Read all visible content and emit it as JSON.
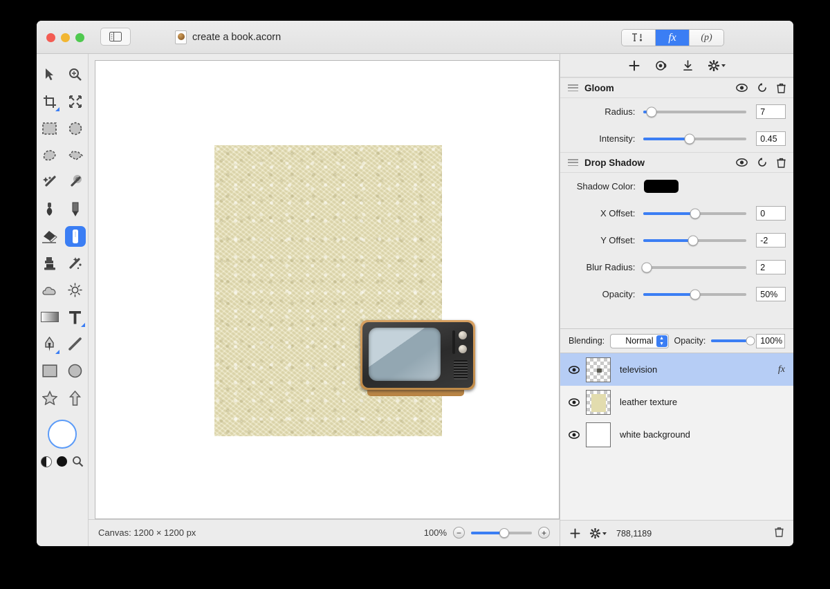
{
  "window": {
    "title": "create a book.acorn",
    "traffic_lights": [
      "close-red",
      "minimize-yellow",
      "zoom-green"
    ],
    "sidebar_toggle_icon": "sidebar-toggle-icon",
    "document_icon": "acorn-document-icon"
  },
  "inspector_tabs": [
    {
      "label": "",
      "icon": "tools-icon",
      "active": false
    },
    {
      "label": "fx",
      "icon": "effects-icon",
      "active": true
    },
    {
      "label": "(p)",
      "icon": "presets-icon",
      "active": false
    }
  ],
  "fx_toolbar": [
    {
      "icon": "plus-icon",
      "label": "+"
    },
    {
      "icon": "preview-eye-icon",
      "label": ""
    },
    {
      "icon": "download-icon",
      "label": ""
    },
    {
      "icon": "gear-dropdown-icon",
      "label": ""
    }
  ],
  "effects": [
    {
      "name": "Gloom",
      "icons": [
        "eye-icon",
        "reset-icon",
        "trash-icon"
      ],
      "params": [
        {
          "label": "Radius:",
          "value": "7",
          "fill": 8,
          "knob": 8,
          "type": "slider"
        },
        {
          "label": "Intensity:",
          "value": "0.45",
          "fill": 45,
          "knob": 45,
          "type": "slider"
        }
      ]
    },
    {
      "name": "Drop Shadow",
      "icons": [
        "eye-icon",
        "reset-icon",
        "trash-icon"
      ],
      "params": [
        {
          "label": "Shadow Color:",
          "value": "#000000",
          "type": "color"
        },
        {
          "label": "X Offset:",
          "value": "0",
          "fill": 50,
          "knob": 50,
          "type": "slider"
        },
        {
          "label": "Y Offset:",
          "value": "-2",
          "fill": 48,
          "knob": 48,
          "type": "slider"
        },
        {
          "label": "Blur Radius:",
          "value": "2",
          "fill": 3,
          "knob": 3,
          "type": "slider"
        },
        {
          "label": "Opacity:",
          "value": "50%",
          "fill": 50,
          "knob": 50,
          "type": "slider"
        }
      ]
    }
  ],
  "blending": {
    "label": "Blending:",
    "mode": "Normal",
    "opacity_label": "Opacity:",
    "opacity_value": "100%"
  },
  "layers": [
    {
      "name": "television",
      "visible_icon": "eye-icon",
      "thumb": "checker-tv",
      "fx_badge": "fx",
      "selected": true
    },
    {
      "name": "leather texture",
      "visible_icon": "eye-icon",
      "thumb": "checker-leather",
      "fx_badge": "",
      "selected": false
    },
    {
      "name": "white background",
      "visible_icon": "eye-icon",
      "thumb": "white",
      "fx_badge": "",
      "selected": false
    }
  ],
  "layer_toolbar": {
    "add_icon": "plus-icon",
    "gear_icon": "gear-dropdown-icon",
    "coordinates": "788,1189",
    "delete_icon": "trash-icon"
  },
  "statusbar": {
    "canvas_size": "Canvas: 1200 × 1200 px",
    "zoom_level": "100%",
    "zoom_out_icon": "minus-circle-icon",
    "zoom_in_icon": "plus-circle-icon"
  },
  "tools": [
    "move-icon",
    "zoom-icon",
    "crop-icon",
    "transform-icon",
    "rectangular-select-icon",
    "elliptical-select-icon",
    "lasso-icon",
    "polygon-lasso-icon",
    "magic-wand-icon",
    "instant-alpha-icon",
    "bucket-fill-icon",
    "pencil-icon",
    "eraser-icon",
    "paint-brush-icon",
    "clone-stamp-icon",
    "smudge-icon",
    "dodge-cloud-icon",
    "burn-sun-icon",
    "gradient-icon",
    "text-icon",
    "pen-icon",
    "line-icon",
    "rectangle-shape-icon",
    "ellipse-shape-icon",
    "star-shape-icon",
    "arrow-shape-icon"
  ],
  "tool_selected_index": 13,
  "color_well": {
    "foreground": "#ffffff",
    "swap_icon": "swap-colors-icon",
    "black_icon": "black-swatch-icon",
    "picker_icon": "magnifier-icon"
  },
  "colors": {
    "accent": "#3b7ef4",
    "panel": "#ececec",
    "leather": "#e9e3ba",
    "selection": "#b6cdf5"
  }
}
